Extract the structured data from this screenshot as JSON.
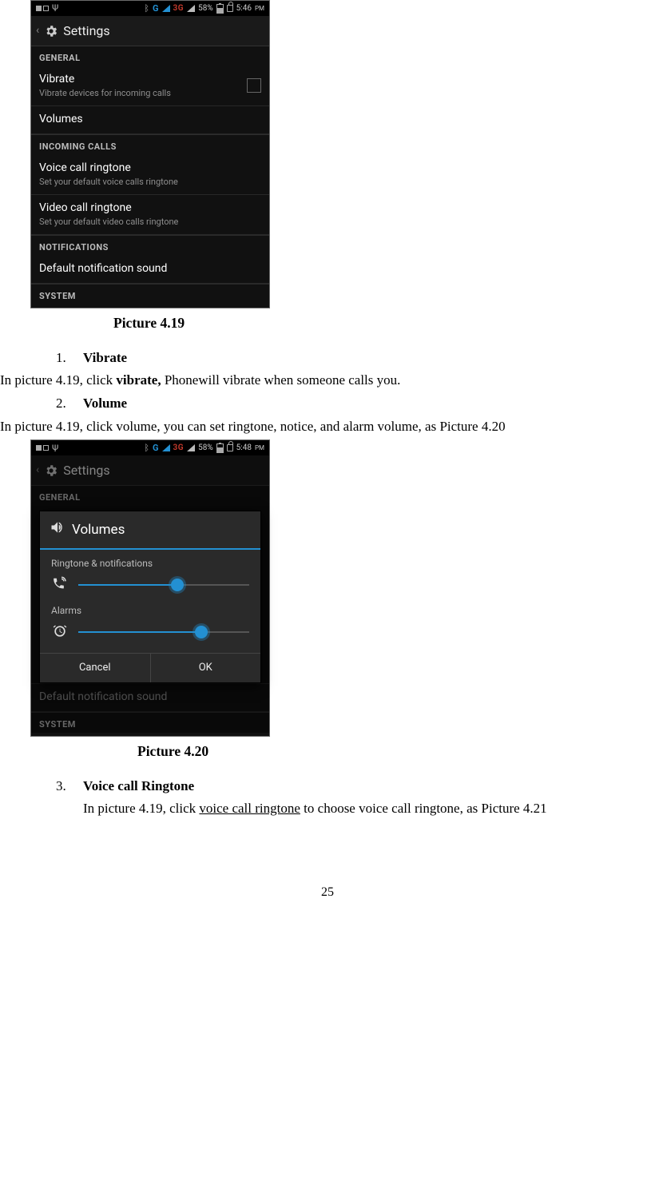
{
  "statusbar": {
    "g": "G",
    "threeg": "3G",
    "battery_pct": "58%",
    "time_1": "5:46",
    "time_2": "5:48",
    "ampm": "PM",
    "bt": "ᛒ",
    "psi": "Ψ"
  },
  "appbar": {
    "title": "Settings"
  },
  "settings": {
    "general": "GENERAL",
    "vibrate_title": "Vibrate",
    "vibrate_sub": "Vibrate devices for incoming calls",
    "volumes": "Volumes",
    "incoming_calls": "INCOMING CALLS",
    "voice_title": "Voice call ringtone",
    "voice_sub": "Set your default voice calls ringtone",
    "video_title": "Video call ringtone",
    "video_sub": "Set your default video calls ringtone",
    "notifications": "NOTIFICATIONS",
    "default_notif": "Default notification sound",
    "system": "SYSTEM"
  },
  "dialog": {
    "title": "Volumes",
    "ring_label": "Ringtone & notifications",
    "alarms_label": "Alarms",
    "cancel": "Cancel",
    "ok": "OK",
    "ring_value_pct": 58,
    "alarm_value_pct": 72
  },
  "doc": {
    "caption_419": "Picture 4.19",
    "caption_420": "Picture 4.20",
    "item1_num": "1.",
    "item1_label": "Vibrate",
    "line1_a": "In picture 4.19, click ",
    "line1_b": "vibrate,",
    "line1_c": " Phonewill vibrate when someone calls you.",
    "item2_num": "2.",
    "item2_label": "Volume",
    "line2": "In picture 4.19, click volume, you can set ringtone, notice, and alarm volume, as Picture 4.20",
    "item3_num": "3.",
    "item3_label": "Voice call Ringtone",
    "line3_a": "In picture 4.19, click ",
    "line3_b": "voice call ringtone",
    "line3_c": " to choose voice call ringtone, as Picture 4.21",
    "page_number": "25"
  }
}
